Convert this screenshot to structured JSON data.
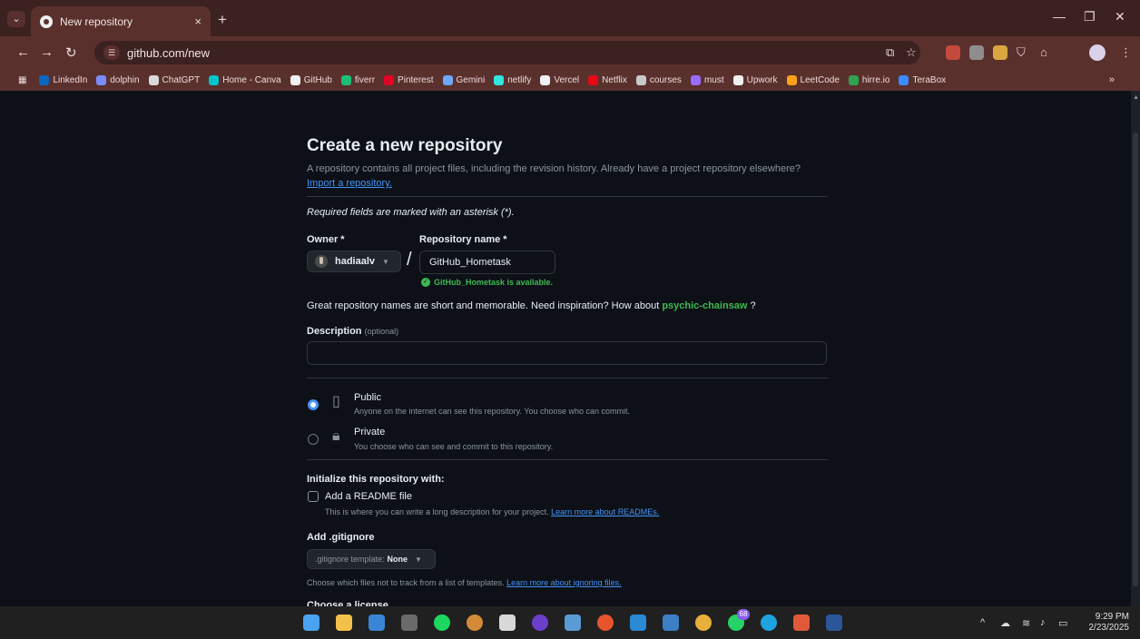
{
  "browser": {
    "tab_title": "New repository",
    "tab_close": "×",
    "new_tab": "+",
    "url": "github.com/new",
    "bookmarks": [
      {
        "label": "LinkedIn",
        "color": "#0a66c2"
      },
      {
        "label": "dolphin",
        "color": "#7b8cff"
      },
      {
        "label": "ChatGPT",
        "color": "#d9d9d9"
      },
      {
        "label": "Home - Canva",
        "color": "#00c4cc"
      },
      {
        "label": "GitHub",
        "color": "#f0f0f0"
      },
      {
        "label": "fiverr",
        "color": "#1dbf73"
      },
      {
        "label": "Pinterest",
        "color": "#e60023"
      },
      {
        "label": "Gemini",
        "color": "#6ea8ff"
      },
      {
        "label": "netlify",
        "color": "#32e6e2"
      },
      {
        "label": "Vercel",
        "color": "#f0f0f0"
      },
      {
        "label": "Netflix",
        "color": "#e50914"
      },
      {
        "label": "courses",
        "color": "#c8c8c8"
      },
      {
        "label": "must",
        "color": "#9b6bff"
      },
      {
        "label": "Upwork",
        "color": "#f0f0f0"
      },
      {
        "label": "LeetCode",
        "color": "#ffa116"
      },
      {
        "label": "hirre.io",
        "color": "#2ea44f"
      },
      {
        "label": "TeraBox",
        "color": "#3c8cff"
      }
    ],
    "bookmarks_more": "»"
  },
  "page": {
    "title": "Create a new repository",
    "subtitle": "A repository contains all project files, including the revision history. Already have a project repository elsewhere?",
    "import_link": "Import a repository.",
    "required_note": "Required fields are marked with an asterisk (*).",
    "owner_label": "Owner *",
    "owner_value": "hadiaalv",
    "slash": "/",
    "repo_label": "Repository name *",
    "repo_value": "GitHub_Hometask",
    "availability": "GitHub_Hometask is available.",
    "inspiration_text": "Great repository names are short and memorable. Need inspiration? How about",
    "suggestion": "psychic-chainsaw",
    "inspiration_end": "?",
    "description_label": "Description",
    "description_optional": "(optional)",
    "public_title": "Public",
    "public_desc": "Anyone on the internet can see this repository. You choose who can commit.",
    "private_title": "Private",
    "private_desc": "You choose who can see and commit to this repository.",
    "init_heading": "Initialize this repository with:",
    "readme_label": "Add a README file",
    "readme_desc": "This is where you can write a long description for your project.",
    "readme_link": "Learn more about READMEs.",
    "gitignore_heading": "Add .gitignore",
    "gitignore_prefix": ".gitignore template:",
    "gitignore_value": "None",
    "gitignore_desc": "Choose which files not to track from a list of templates.",
    "gitignore_link": "Learn more about ignoring files.",
    "license_heading": "Choose a license"
  },
  "taskbar": {
    "time": "9:29 PM",
    "date": "2/23/2025",
    "badge": "68"
  }
}
